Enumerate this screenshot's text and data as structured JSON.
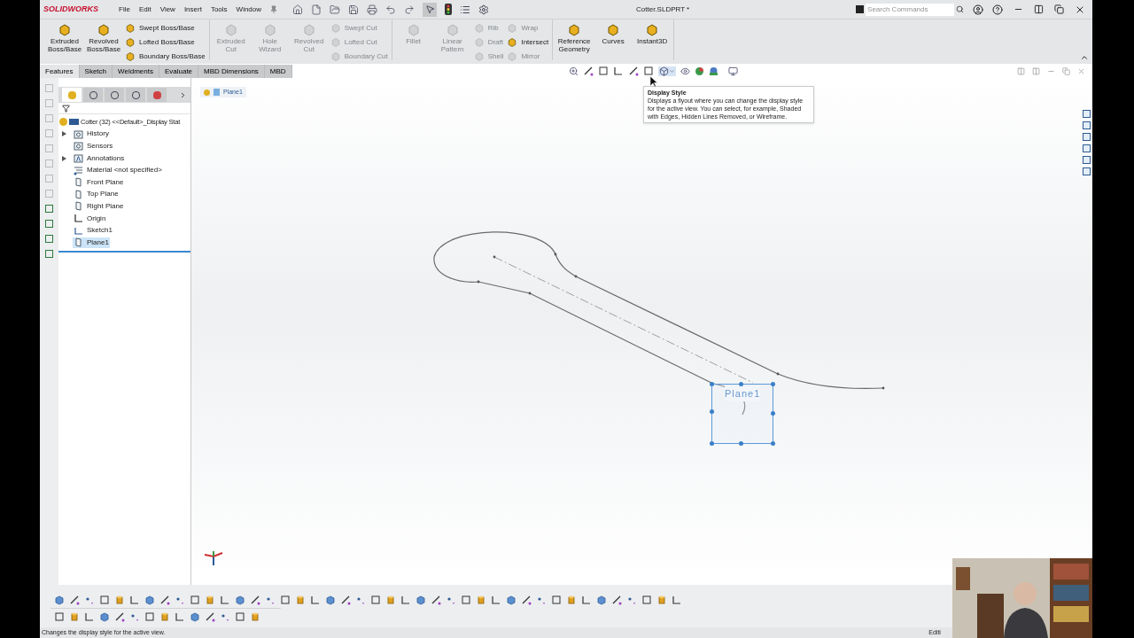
{
  "app": {
    "logo": "SOLIDWORKS",
    "menu": [
      "File",
      "Edit",
      "View",
      "Insert",
      "Tools",
      "Window"
    ],
    "title": "Cotter.SLDPRT *",
    "search": {
      "placeholder": "Search Commands"
    }
  },
  "ribbon": [
    {
      "items": [
        {
          "kind": "large",
          "label": "Extruded Boss/Base",
          "disabled": false
        },
        {
          "kind": "large",
          "label": "Revolved Boss/Base",
          "disabled": false
        },
        {
          "kind": "small",
          "label": "Swept Boss/Base",
          "disabled": false
        },
        {
          "kind": "small",
          "label": "Lofted Boss/Base",
          "disabled": false
        },
        {
          "kind": "small",
          "label": "Boundary Boss/Base",
          "disabled": false
        }
      ]
    },
    {
      "items": [
        {
          "kind": "large",
          "label": "Extruded Cut",
          "disabled": true
        },
        {
          "kind": "large",
          "label": "Hole Wizard",
          "disabled": true
        },
        {
          "kind": "large",
          "label": "Revolved Cut",
          "disabled": true
        },
        {
          "kind": "small",
          "label": "Swept Cut",
          "disabled": true
        },
        {
          "kind": "small",
          "label": "Lofted Cut",
          "disabled": true
        },
        {
          "kind": "small",
          "label": "Boundary Cut",
          "disabled": true
        }
      ]
    },
    {
      "items": [
        {
          "kind": "large",
          "label": "Fillet",
          "disabled": true
        },
        {
          "kind": "large",
          "label": "Linear Pattern",
          "disabled": true
        },
        {
          "kind": "small",
          "label": "Rib",
          "disabled": true
        },
        {
          "kind": "small",
          "label": "Draft",
          "disabled": true
        },
        {
          "kind": "small",
          "label": "Shell",
          "disabled": true
        },
        {
          "kind": "small",
          "label": "Wrap",
          "disabled": true
        },
        {
          "kind": "small",
          "label": "Intersect",
          "disabled": false
        },
        {
          "kind": "small",
          "label": "Mirror",
          "disabled": true
        }
      ]
    },
    {
      "items": [
        {
          "kind": "large",
          "label": "Reference Geometry",
          "disabled": false
        },
        {
          "kind": "large",
          "label": "Curves",
          "disabled": false
        },
        {
          "kind": "large",
          "label": "Instant3D",
          "disabled": false
        }
      ]
    }
  ],
  "command_tabs": [
    {
      "label": "Features",
      "selected": true
    },
    {
      "label": "Sketch",
      "selected": false
    },
    {
      "label": "Weldments",
      "selected": false
    },
    {
      "label": "Evaluate",
      "selected": false
    },
    {
      "label": "MBD Dimensions",
      "selected": false
    },
    {
      "label": "MBD",
      "selected": false
    }
  ],
  "feature_tree": {
    "root": "Cotter (32) <<Default>_Display Stat",
    "items": [
      {
        "kind": "folder",
        "label": "History",
        "has_children": true,
        "selected": false
      },
      {
        "kind": "folder",
        "label": "Sensors",
        "has_children": false,
        "selected": false
      },
      {
        "kind": "annotation",
        "label": "Annotations",
        "has_children": true,
        "selected": false
      },
      {
        "kind": "material",
        "label": "Material <not specified>",
        "has_children": false,
        "selected": false
      },
      {
        "kind": "plane",
        "label": "Front Plane",
        "has_children": false,
        "selected": false
      },
      {
        "kind": "plane",
        "label": "Top Plane",
        "has_children": false,
        "selected": false
      },
      {
        "kind": "plane",
        "label": "Right Plane",
        "has_children": false,
        "selected": false
      },
      {
        "kind": "origin",
        "label": "Origin",
        "has_children": false,
        "selected": false
      },
      {
        "kind": "sketch",
        "label": "Sketch1",
        "has_children": false,
        "selected": false
      },
      {
        "kind": "plane",
        "label": "Plane1",
        "has_children": false,
        "selected": true
      }
    ]
  },
  "breadcrumb": "Plane1",
  "tooltip": {
    "title": "Display Style",
    "text": "Displays a flyout where you can change the display style for the active view. You can select, for example, Shaded with Edges, Hidden Lines Removed, or Wireframe."
  },
  "graphics": {
    "plane_label": "Plane1"
  },
  "status_bar": {
    "text": "Changes the display style for the active view.",
    "mode": "Editi"
  }
}
